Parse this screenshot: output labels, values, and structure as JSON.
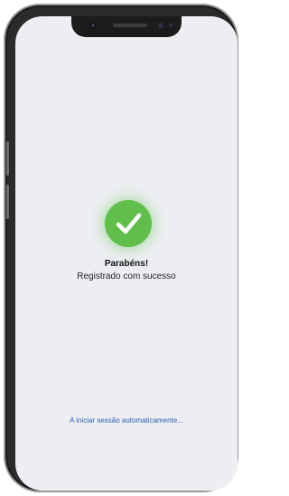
{
  "success": {
    "icon": "check-icon",
    "accent_color": "#5fbf4a",
    "title": "Parabéns!",
    "message": "Registrado com sucesso"
  },
  "footer": {
    "auto_login_text": "A iniciar sessão automaticamente...",
    "link_color": "#2f5fae"
  }
}
